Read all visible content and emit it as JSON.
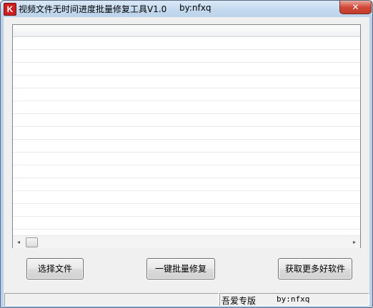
{
  "window": {
    "title": "视频文件无时间进度批量修复工具V1.0",
    "title_by": "by:nfxq",
    "icon": "K",
    "close_glyph": "✕"
  },
  "listview": {
    "scroll_left_glyph": "◂",
    "scroll_right_glyph": "▸"
  },
  "buttons": {
    "select_file": "选择文件",
    "batch_fix": "一键批量修复",
    "more_software": "获取更多好软件"
  },
  "statusbar": {
    "label": "吾爱专版",
    "by": "by:nfxq"
  }
}
